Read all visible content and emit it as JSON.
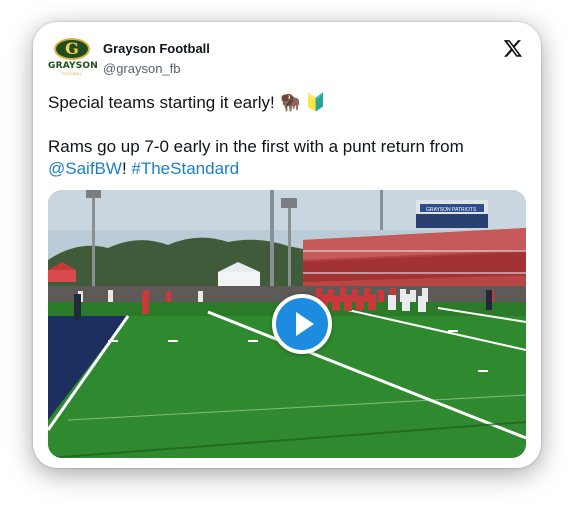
{
  "account": {
    "name": "Grayson Football",
    "handle": "@grayson_fb",
    "logo_word": "GRAYSON",
    "logo_letter": "G",
    "logo_sub": "FOOTBALL"
  },
  "tweet": {
    "line1": "Special teams starting it early! 🦬 🔰",
    "line2_prefix": "Rams go up 7-0 early in the first with a punt return from ",
    "mention": "@SaifBW",
    "exclaim": "! ",
    "hashtag": "#TheStandard"
  },
  "media": {
    "scoreboard_text": "GRAYSON PATRIOTS",
    "type": "video",
    "play_icon": "play-icon"
  },
  "colors": {
    "link": "#1d7fc8",
    "play_button": "#1d8be0",
    "field_green": "#2f8a2f",
    "endzone_navy": "#1c2f5e"
  }
}
